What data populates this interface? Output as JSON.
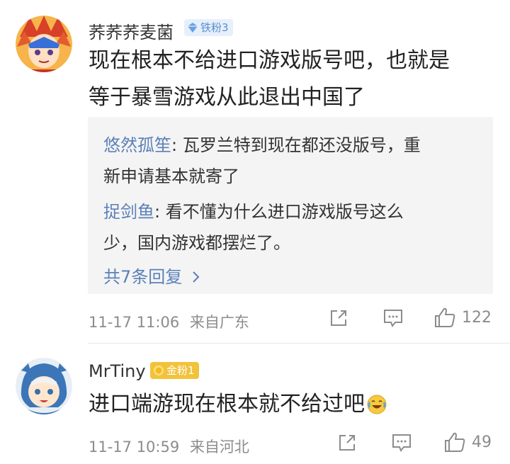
{
  "comments": [
    {
      "username": "荞荞荞麦菌",
      "badge": "铁粉3",
      "text_line1": "现在根本不给进口游戏版号吧，也就是",
      "text_line2": "等于暴雪游戏从此退出中国了",
      "replies": [
        {
          "name": "悠然孤笙",
          "colon": ": ",
          "text_line1": "瓦罗兰特到现在都还没版号，重",
          "text_line2": "新申请基本就寄了"
        },
        {
          "name": "捉剑鱼",
          "colon": ": ",
          "text_line1": "看不懂为什么进口游戏版号这么",
          "text_line2": "少，国内游戏都摆烂了。"
        }
      ],
      "more_replies": "共7条回复",
      "time": "11-17 11:06",
      "location": "来自广东",
      "likes": "122"
    },
    {
      "username": "MrTiny",
      "badge": "金粉1",
      "text": "进口端游现在根本就不给过吧",
      "emoji": "laugh-cry-emoji",
      "time": "11-17 10:59",
      "location": "来自河北",
      "likes": "49"
    }
  ],
  "icons": {
    "share": "share-icon",
    "comment": "comment-icon",
    "like": "like-icon",
    "chevron": "chevron-right-icon",
    "iron_badge": "diamond-icon",
    "gold_badge": "coin-icon"
  },
  "colors": {
    "link": "#5b80b8",
    "meta": "#8c8c8c",
    "reply_bg": "#f4f4f4",
    "iron_badge_bg": "#e6f0fb",
    "gold_badge_bg": "#f2c23b"
  }
}
